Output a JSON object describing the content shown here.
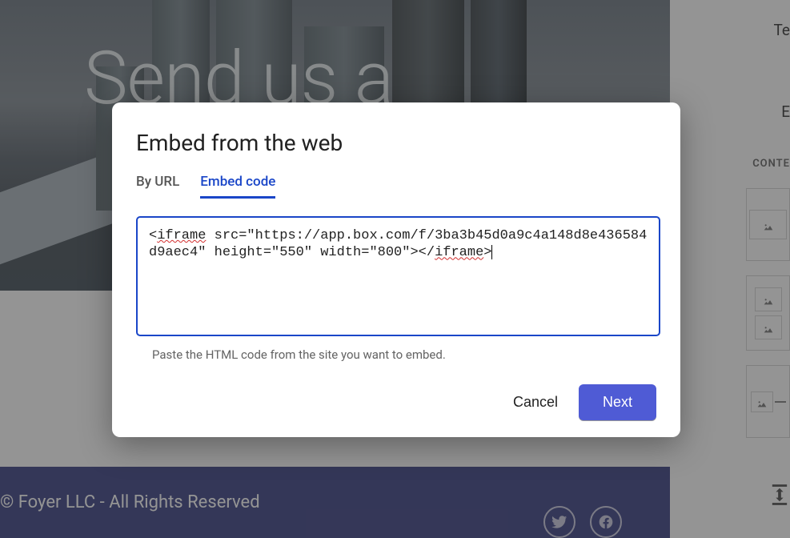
{
  "hero": {
    "title": "Send us a"
  },
  "footer": {
    "copyright": "© Foyer LLC - All Rights Reserved"
  },
  "rightPanel": {
    "field1": "Te",
    "field2": "E",
    "section": "CONTE"
  },
  "dialog": {
    "title": "Embed from the web",
    "tabs": {
      "byUrl": "By URL",
      "embedCode": "Embed code"
    },
    "code": {
      "prefix": "<",
      "tag1": "iframe",
      "mid": " src=\"https://app.box.com/f/3ba3b45d0a9c4a148d8e436584d9aec4\" height=\"550\" width=\"800\"></",
      "tag2": "iframe",
      "suffix": ">"
    },
    "hint": "Paste the HTML code from the site you want to embed.",
    "cancel": "Cancel",
    "next": "Next"
  }
}
